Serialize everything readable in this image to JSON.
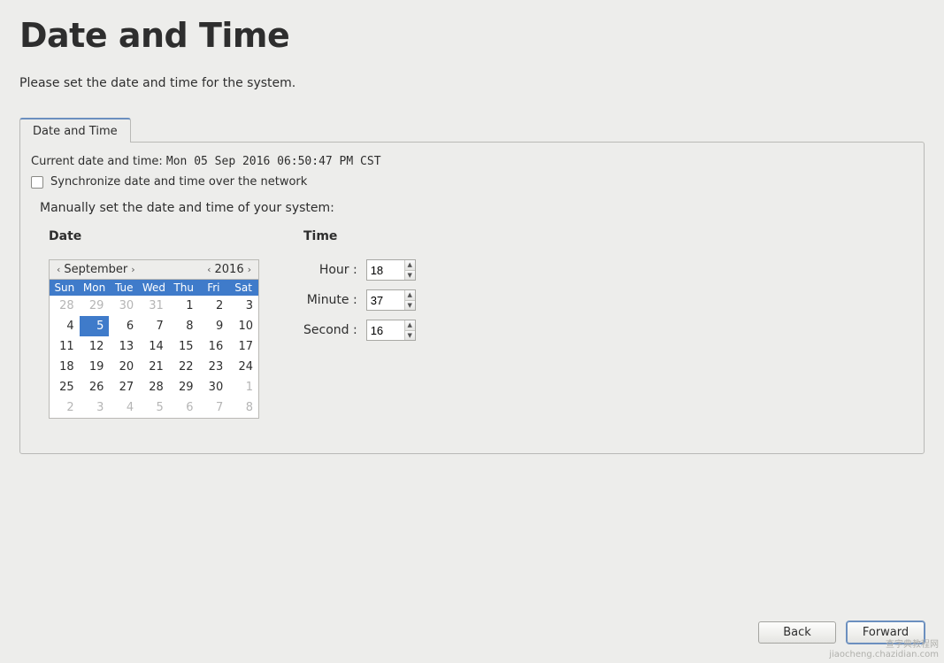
{
  "title": "Date and Time",
  "intro": "Please set the date and time for the system.",
  "tab_label": "Date and Time",
  "current_label": "Current date and time:",
  "current_value": "Mon 05 Sep 2016 06:50:47 PM CST",
  "sync_label": "Synchronize date and time over the network",
  "manual_label": "Manually set the date and time of your system:",
  "date_heading": "Date",
  "time_heading": "Time",
  "calendar": {
    "month": "September",
    "year": "2016",
    "weekdays": [
      "Sun",
      "Mon",
      "Tue",
      "Wed",
      "Thu",
      "Fri",
      "Sat"
    ],
    "weeks": [
      [
        {
          "d": "28",
          "dim": true
        },
        {
          "d": "29",
          "dim": true
        },
        {
          "d": "30",
          "dim": true
        },
        {
          "d": "31",
          "dim": true
        },
        {
          "d": "1"
        },
        {
          "d": "2"
        },
        {
          "d": "3"
        }
      ],
      [
        {
          "d": "4"
        },
        {
          "d": "5",
          "sel": true
        },
        {
          "d": "6"
        },
        {
          "d": "7"
        },
        {
          "d": "8"
        },
        {
          "d": "9"
        },
        {
          "d": "10"
        }
      ],
      [
        {
          "d": "11"
        },
        {
          "d": "12"
        },
        {
          "d": "13"
        },
        {
          "d": "14"
        },
        {
          "d": "15"
        },
        {
          "d": "16"
        },
        {
          "d": "17"
        }
      ],
      [
        {
          "d": "18"
        },
        {
          "d": "19"
        },
        {
          "d": "20"
        },
        {
          "d": "21"
        },
        {
          "d": "22"
        },
        {
          "d": "23"
        },
        {
          "d": "24"
        }
      ],
      [
        {
          "d": "25"
        },
        {
          "d": "26"
        },
        {
          "d": "27"
        },
        {
          "d": "28"
        },
        {
          "d": "29"
        },
        {
          "d": "30"
        },
        {
          "d": "1",
          "dim": true
        }
      ],
      [
        {
          "d": "2",
          "dim": true
        },
        {
          "d": "3",
          "dim": true
        },
        {
          "d": "4",
          "dim": true
        },
        {
          "d": "5",
          "dim": true
        },
        {
          "d": "6",
          "dim": true
        },
        {
          "d": "7",
          "dim": true
        },
        {
          "d": "8",
          "dim": true
        }
      ]
    ]
  },
  "time": {
    "hour_label": "Hour :",
    "minute_label": "Minute :",
    "second_label": "Second :",
    "hour": "18",
    "minute": "37",
    "second": "16"
  },
  "buttons": {
    "back": "Back",
    "forward": "Forward"
  },
  "watermark": {
    "line1": "查字典教程网",
    "line2": "jiaocheng.chazidian.com"
  }
}
